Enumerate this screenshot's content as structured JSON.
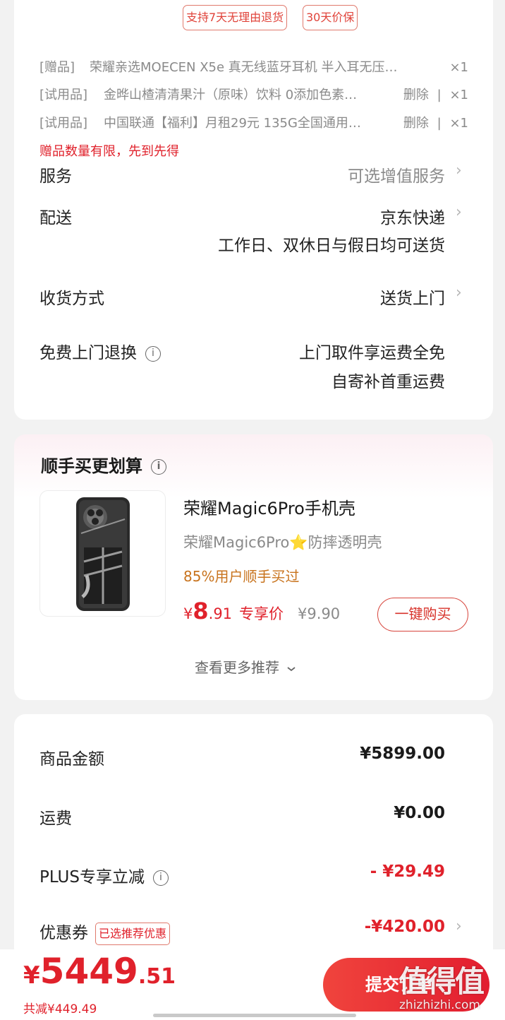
{
  "tags": [
    "支持7天无理由退货",
    "30天价保"
  ],
  "gifts": [
    {
      "category": "[赠品]",
      "name": "荣耀亲选MOECEN X5e 真无线蓝牙耳机 半入耳无压…",
      "action": "",
      "qty": "×1"
    },
    {
      "category": "[试用品]",
      "name": "金晔山楂清清果汁（原味）饮料 0添加色素…",
      "action": "删除",
      "qty": "×1"
    },
    {
      "category": "[试用品]",
      "name": "中国联通【福利】月租29元 135G全国通用…",
      "action": "删除",
      "qty": "×1"
    }
  ],
  "gift_note": "赠品数量有限，先到先得",
  "service": {
    "label": "服务",
    "value": "可选增值服务"
  },
  "delivery": {
    "label": "配送",
    "value": "京东快递",
    "note": "工作日、双休日与假日均可送货"
  },
  "receive": {
    "label": "收货方式",
    "value": "送货上门"
  },
  "free_return": {
    "label": "免费上门退换",
    "line1": "上门取件享运费全免",
    "line2": "自寄补首重运费"
  },
  "recommend": {
    "title": "顺手买更划算",
    "product_title": "荣耀Magic6Pro手机壳",
    "product_subtitle": "荣耀Magic6Pro⭐防摔透明壳",
    "hint": "85%用户顺手买过",
    "price_currency": "¥",
    "price_int": "8",
    "price_dec": ".91",
    "price_tag": "专享价",
    "orig_price": "¥9.90",
    "buy_label": "一键购买",
    "more_label": "查看更多推荐"
  },
  "summary": {
    "goods_label": "商品金额",
    "goods_value": "¥5899.00",
    "shipping_label": "运费",
    "shipping_value": "¥0.00",
    "plus_label": "PLUS专享立减",
    "plus_value": "- ¥29.49",
    "coupon_label": "优惠券",
    "coupon_badge": "已选推荐优惠",
    "coupon_value": "-¥420.00"
  },
  "bottom": {
    "currency": "¥",
    "total_int": "5449",
    "total_dec": ".51",
    "saved": "共减¥449.49",
    "submit_label": "提交订单"
  },
  "watermark": {
    "main": "值得值",
    "sub": "zhizhizhi.com"
  },
  "colors": {
    "accent": "#e0212b",
    "hint": "#c8731d",
    "muted": "#8a8a8a"
  }
}
